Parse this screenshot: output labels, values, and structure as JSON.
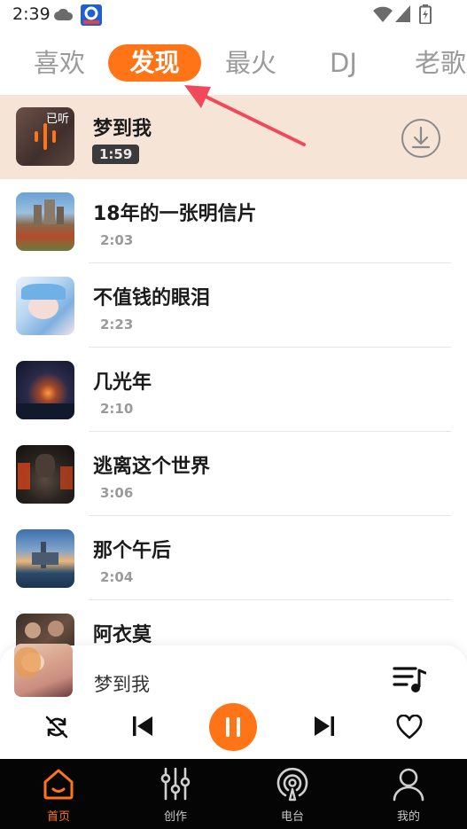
{
  "status_bar": {
    "time": "2:39"
  },
  "tabs": [
    {
      "label": "喜欢",
      "active": false
    },
    {
      "label": "发现",
      "active": true
    },
    {
      "label": "最火",
      "active": false
    },
    {
      "label": "DJ",
      "active": false
    },
    {
      "label": "老歌",
      "active": false
    }
  ],
  "songs": [
    {
      "title": "梦到我",
      "duration": "1:59",
      "current": true,
      "heard_label": "已听"
    },
    {
      "title": "18年的一张明信片",
      "duration": "2:03"
    },
    {
      "title": "不值钱的眼泪",
      "duration": "2:23"
    },
    {
      "title": "几光年",
      "duration": "2:10"
    },
    {
      "title": "逃离这个世界",
      "duration": "3:06"
    },
    {
      "title": "那个午后",
      "duration": "2:04"
    },
    {
      "title": "阿衣莫",
      "duration": ""
    }
  ],
  "player": {
    "title": "梦到我"
  },
  "bottom_nav": [
    {
      "label": "首页",
      "icon": "home-icon",
      "active": true
    },
    {
      "label": "创作",
      "icon": "sliders-icon",
      "active": false
    },
    {
      "label": "电台",
      "icon": "radio-icon",
      "active": false
    },
    {
      "label": "我的",
      "icon": "profile-icon",
      "active": false
    }
  ],
  "colors": {
    "accent": "#ff7416",
    "current_row": "#f6e5d7",
    "annotation_arrow": "#f04a5a",
    "nav_bg": "#050505"
  }
}
